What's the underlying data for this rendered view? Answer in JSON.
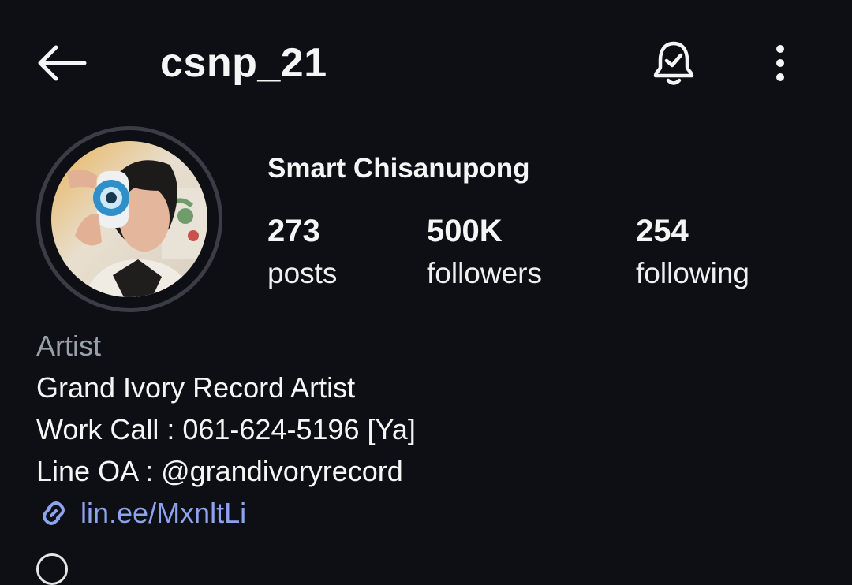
{
  "header": {
    "username": "csnp_21",
    "back_icon": "arrow-left-icon",
    "notification_icon": "bell-check-icon",
    "more_icon": "vertical-ellipsis-icon"
  },
  "profile": {
    "avatar_alt": "profile photo",
    "display_name": "Smart Chisanupong",
    "stats": {
      "posts": {
        "value": "273",
        "label": "posts"
      },
      "followers": {
        "value": "500K",
        "label": "followers"
      },
      "following": {
        "value": "254",
        "label": "following"
      }
    }
  },
  "bio": {
    "category": "Artist",
    "lines": [
      "Grand Ivory Record Artist",
      "Work Call : 061-624-5196 [Ya]",
      "Line OA : @grandivoryrecord"
    ],
    "link": "lin.ee/MxnltLi",
    "link_icon": "link-icon"
  },
  "colors": {
    "background": "#0d0f14",
    "text": "#f5f5f5",
    "muted": "#9aa0a8",
    "link": "#8ea3f0",
    "avatar_ring": "#3a3d44"
  }
}
